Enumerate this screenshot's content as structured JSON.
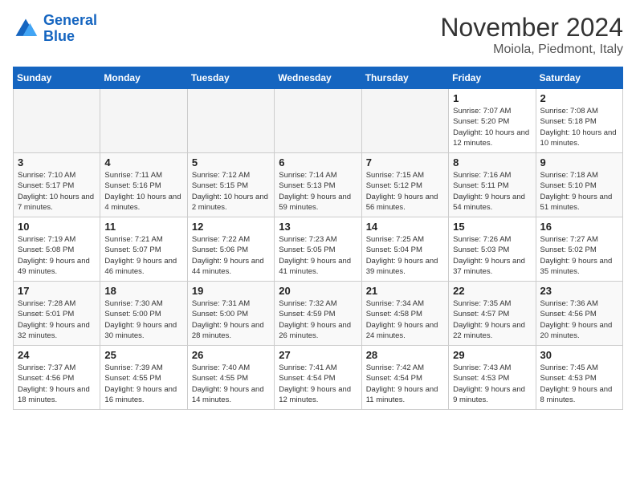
{
  "header": {
    "logo_line1": "General",
    "logo_line2": "Blue",
    "month": "November 2024",
    "location": "Moiola, Piedmont, Italy"
  },
  "weekdays": [
    "Sunday",
    "Monday",
    "Tuesday",
    "Wednesday",
    "Thursday",
    "Friday",
    "Saturday"
  ],
  "weeks": [
    [
      {
        "day": "",
        "info": ""
      },
      {
        "day": "",
        "info": ""
      },
      {
        "day": "",
        "info": ""
      },
      {
        "day": "",
        "info": ""
      },
      {
        "day": "",
        "info": ""
      },
      {
        "day": "1",
        "info": "Sunrise: 7:07 AM\nSunset: 5:20 PM\nDaylight: 10 hours and 12 minutes."
      },
      {
        "day": "2",
        "info": "Sunrise: 7:08 AM\nSunset: 5:18 PM\nDaylight: 10 hours and 10 minutes."
      }
    ],
    [
      {
        "day": "3",
        "info": "Sunrise: 7:10 AM\nSunset: 5:17 PM\nDaylight: 10 hours and 7 minutes."
      },
      {
        "day": "4",
        "info": "Sunrise: 7:11 AM\nSunset: 5:16 PM\nDaylight: 10 hours and 4 minutes."
      },
      {
        "day": "5",
        "info": "Sunrise: 7:12 AM\nSunset: 5:15 PM\nDaylight: 10 hours and 2 minutes."
      },
      {
        "day": "6",
        "info": "Sunrise: 7:14 AM\nSunset: 5:13 PM\nDaylight: 9 hours and 59 minutes."
      },
      {
        "day": "7",
        "info": "Sunrise: 7:15 AM\nSunset: 5:12 PM\nDaylight: 9 hours and 56 minutes."
      },
      {
        "day": "8",
        "info": "Sunrise: 7:16 AM\nSunset: 5:11 PM\nDaylight: 9 hours and 54 minutes."
      },
      {
        "day": "9",
        "info": "Sunrise: 7:18 AM\nSunset: 5:10 PM\nDaylight: 9 hours and 51 minutes."
      }
    ],
    [
      {
        "day": "10",
        "info": "Sunrise: 7:19 AM\nSunset: 5:08 PM\nDaylight: 9 hours and 49 minutes."
      },
      {
        "day": "11",
        "info": "Sunrise: 7:21 AM\nSunset: 5:07 PM\nDaylight: 9 hours and 46 minutes."
      },
      {
        "day": "12",
        "info": "Sunrise: 7:22 AM\nSunset: 5:06 PM\nDaylight: 9 hours and 44 minutes."
      },
      {
        "day": "13",
        "info": "Sunrise: 7:23 AM\nSunset: 5:05 PM\nDaylight: 9 hours and 41 minutes."
      },
      {
        "day": "14",
        "info": "Sunrise: 7:25 AM\nSunset: 5:04 PM\nDaylight: 9 hours and 39 minutes."
      },
      {
        "day": "15",
        "info": "Sunrise: 7:26 AM\nSunset: 5:03 PM\nDaylight: 9 hours and 37 minutes."
      },
      {
        "day": "16",
        "info": "Sunrise: 7:27 AM\nSunset: 5:02 PM\nDaylight: 9 hours and 35 minutes."
      }
    ],
    [
      {
        "day": "17",
        "info": "Sunrise: 7:28 AM\nSunset: 5:01 PM\nDaylight: 9 hours and 32 minutes."
      },
      {
        "day": "18",
        "info": "Sunrise: 7:30 AM\nSunset: 5:00 PM\nDaylight: 9 hours and 30 minutes."
      },
      {
        "day": "19",
        "info": "Sunrise: 7:31 AM\nSunset: 5:00 PM\nDaylight: 9 hours and 28 minutes."
      },
      {
        "day": "20",
        "info": "Sunrise: 7:32 AM\nSunset: 4:59 PM\nDaylight: 9 hours and 26 minutes."
      },
      {
        "day": "21",
        "info": "Sunrise: 7:34 AM\nSunset: 4:58 PM\nDaylight: 9 hours and 24 minutes."
      },
      {
        "day": "22",
        "info": "Sunrise: 7:35 AM\nSunset: 4:57 PM\nDaylight: 9 hours and 22 minutes."
      },
      {
        "day": "23",
        "info": "Sunrise: 7:36 AM\nSunset: 4:56 PM\nDaylight: 9 hours and 20 minutes."
      }
    ],
    [
      {
        "day": "24",
        "info": "Sunrise: 7:37 AM\nSunset: 4:56 PM\nDaylight: 9 hours and 18 minutes."
      },
      {
        "day": "25",
        "info": "Sunrise: 7:39 AM\nSunset: 4:55 PM\nDaylight: 9 hours and 16 minutes."
      },
      {
        "day": "26",
        "info": "Sunrise: 7:40 AM\nSunset: 4:55 PM\nDaylight: 9 hours and 14 minutes."
      },
      {
        "day": "27",
        "info": "Sunrise: 7:41 AM\nSunset: 4:54 PM\nDaylight: 9 hours and 12 minutes."
      },
      {
        "day": "28",
        "info": "Sunrise: 7:42 AM\nSunset: 4:54 PM\nDaylight: 9 hours and 11 minutes."
      },
      {
        "day": "29",
        "info": "Sunrise: 7:43 AM\nSunset: 4:53 PM\nDaylight: 9 hours and 9 minutes."
      },
      {
        "day": "30",
        "info": "Sunrise: 7:45 AM\nSunset: 4:53 PM\nDaylight: 9 hours and 8 minutes."
      }
    ]
  ]
}
